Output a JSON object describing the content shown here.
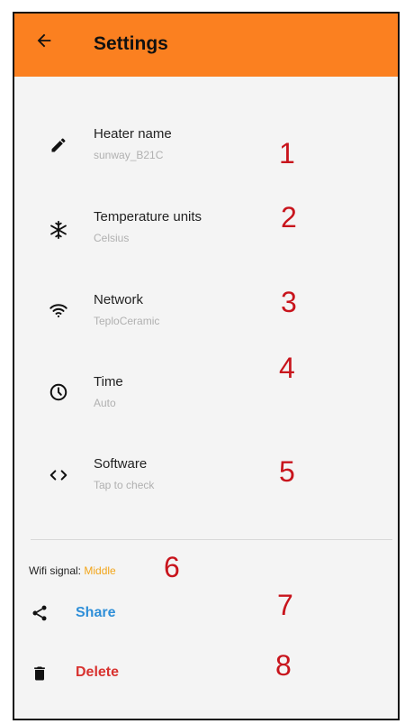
{
  "app_bar": {
    "title": "Settings",
    "back_icon": "back-arrow-icon",
    "color": "#fb8020"
  },
  "settings": [
    {
      "id": "heater-name",
      "label": "Heater name",
      "value": "sunway_B21C",
      "icon": "pencil-icon",
      "annotation": "1"
    },
    {
      "id": "temperature-units",
      "label": "Temperature units",
      "value": "Celsius",
      "icon": "snowflake-icon",
      "annotation": "2"
    },
    {
      "id": "network",
      "label": "Network",
      "value": "TeploCeramic",
      "icon": "wifi-icon",
      "annotation": "3"
    },
    {
      "id": "time",
      "label": "Time",
      "value": "Auto",
      "icon": "clock-icon",
      "annotation": "4"
    },
    {
      "id": "software",
      "label": "Software",
      "value": "Tap to check",
      "icon": "code-icon",
      "annotation": "5"
    }
  ],
  "wifi_signal": {
    "label": "Wifi signal:",
    "value": "Middle",
    "annotation": "6"
  },
  "actions": {
    "share": {
      "label": "Share",
      "icon": "share-icon",
      "color": "#2f8fd8",
      "annotation": "7"
    },
    "delete": {
      "label": "Delete",
      "icon": "trash-icon",
      "color": "#d8322f",
      "annotation": "8"
    }
  },
  "annotation_color": "#c8141c"
}
